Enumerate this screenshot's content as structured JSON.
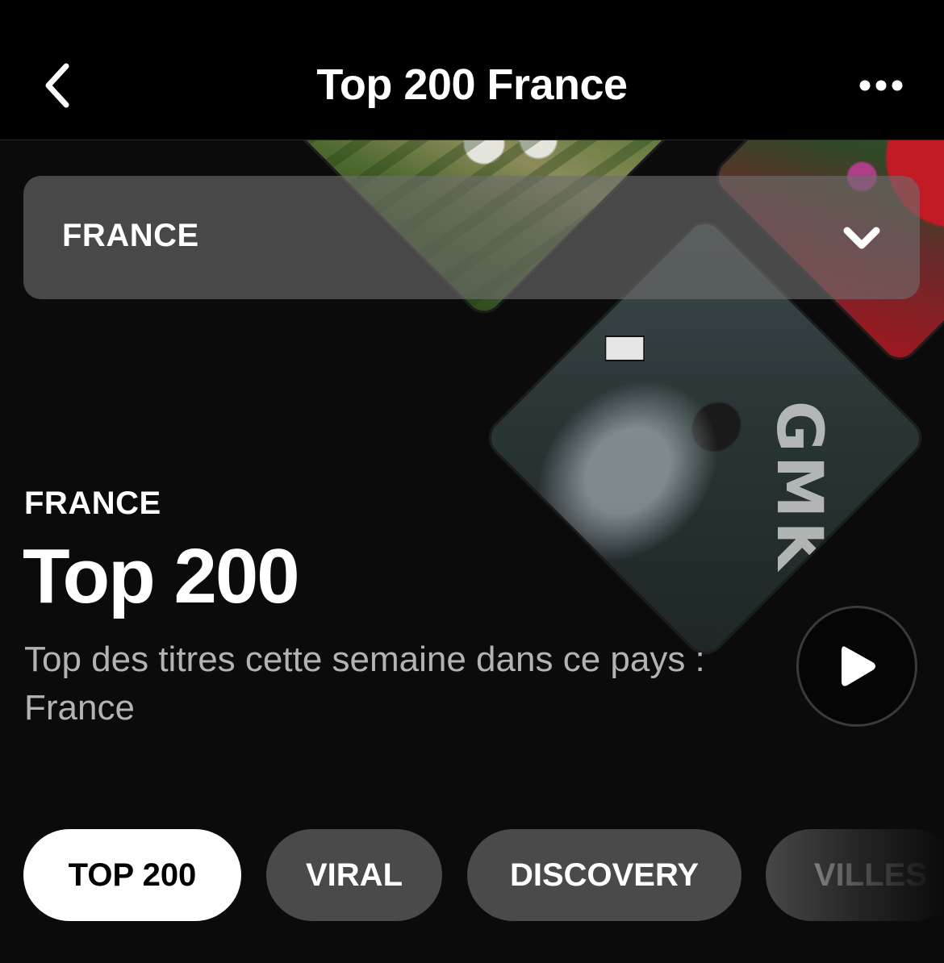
{
  "nav": {
    "title": "Top 200 France",
    "back_icon": "chevron-left-icon",
    "more_icon": "more-horizontal-icon"
  },
  "country_selector": {
    "value": "FRANCE",
    "icon": "chevron-down-icon"
  },
  "header": {
    "region": "FRANCE",
    "title": "Top 200",
    "description": "Top des titres cette semaine dans ce pays : France",
    "play_icon": "play-icon"
  },
  "artwork": {
    "album_b_text": "GMK"
  },
  "tabs": [
    {
      "label": "TOP 200",
      "active": true
    },
    {
      "label": "VIRAL",
      "active": false
    },
    {
      "label": "DISCOVERY",
      "active": false
    },
    {
      "label": "VILLES",
      "active": false
    }
  ],
  "colors": {
    "background": "#0b0b0b",
    "navbar": "#000000",
    "tab_inactive": "#4a4a4a",
    "tab_active": "#ffffff",
    "selector": "#6e6e6e"
  }
}
